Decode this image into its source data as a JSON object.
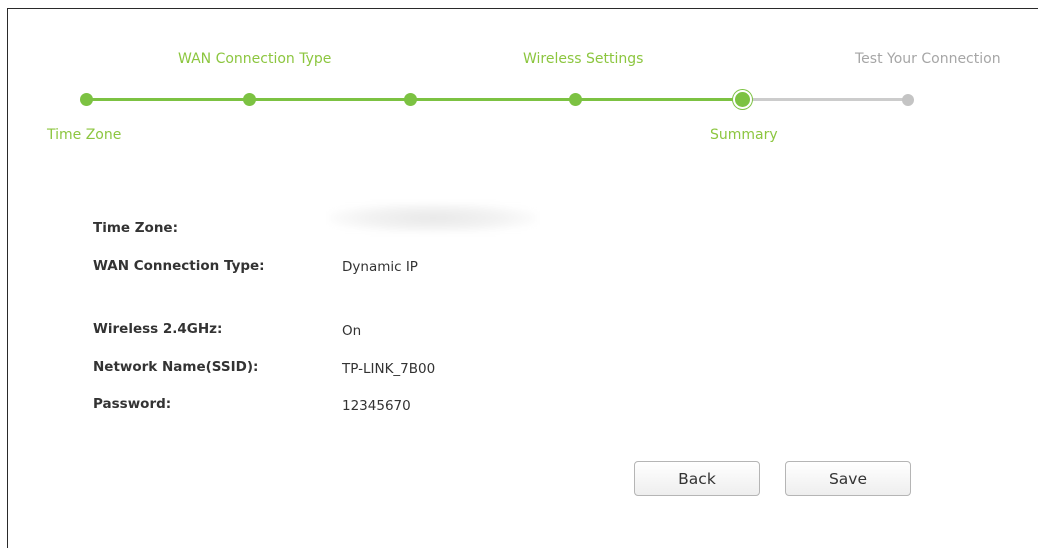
{
  "wizard": {
    "steps_top": [
      {
        "label": "WAN Connection Type"
      },
      {
        "label": "Wireless Settings"
      },
      {
        "label": "Test Your Connection"
      }
    ],
    "steps_bottom": [
      {
        "label": "Time Zone"
      },
      {
        "label": "Summary"
      }
    ],
    "progress": {
      "total_steps": 6,
      "current_step": 5
    },
    "colors": {
      "done": "#7cc242",
      "pending": "#c4c4c4",
      "label_active": "#8cc63f",
      "label_pending": "#a6a6a6"
    }
  },
  "summary": {
    "rows": [
      {
        "label": "Time Zone:",
        "value": ""
      },
      {
        "label": "WAN Connection Type:",
        "value": "Dynamic IP"
      },
      {
        "label": "Wireless 2.4GHz:",
        "value": "On"
      },
      {
        "label": "Network Name(SSID):",
        "value": "TP-LINK_7B00"
      },
      {
        "label": "Password:",
        "value": "12345670"
      }
    ]
  },
  "actions": {
    "back_label": "Back",
    "save_label": "Save"
  }
}
